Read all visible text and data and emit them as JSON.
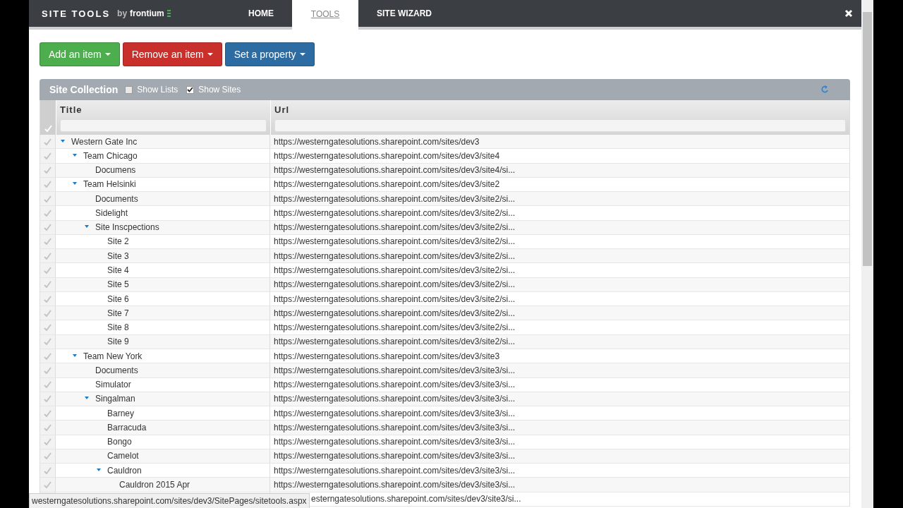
{
  "navbar": {
    "brand": "SITE TOOLS",
    "brand_by": "by",
    "brand_company": "frontium",
    "tabs": [
      {
        "label": "HOME",
        "selected": false
      },
      {
        "label": "TOOLS",
        "selected": true
      },
      {
        "label": "SITE WIZARD",
        "selected": false
      }
    ]
  },
  "actions": [
    {
      "label": "Add an item",
      "kind": "success"
    },
    {
      "label": "Remove an item",
      "kind": "danger"
    },
    {
      "label": "Set a property",
      "kind": "primary"
    }
  ],
  "panel": {
    "title": "Site Collection",
    "options": [
      {
        "label": "Show Lists",
        "checked": false
      },
      {
        "label": "Show Sites",
        "checked": true
      }
    ]
  },
  "table": {
    "columns": [
      "Title",
      "Url"
    ],
    "rows": [
      {
        "title": "Western Gate Inc",
        "url": "https://westerngatesolutions.sharepoint.com/sites/dev3",
        "expanded": true,
        "children": [
          {
            "title": "Team Chicago",
            "url": "https://westerngatesolutions.sharepoint.com/sites/dev3/site4",
            "expanded": true,
            "children": [
              {
                "title": "Documens",
                "url": "https://westerngatesolutions.sharepoint.com/sites/dev3/site4/si..."
              }
            ]
          },
          {
            "title": "Team Helsinki",
            "url": "https://westerngatesolutions.sharepoint.com/sites/dev3/site2",
            "expanded": true,
            "children": [
              {
                "title": "Documents",
                "url": "https://westerngatesolutions.sharepoint.com/sites/dev3/site2/si..."
              },
              {
                "title": "Sidelight",
                "url": "https://westerngatesolutions.sharepoint.com/sites/dev3/site2/si..."
              },
              {
                "title": "Site Inscpections",
                "url": "https://westerngatesolutions.sharepoint.com/sites/dev3/site2/si...",
                "expanded": true,
                "children": [
                  {
                    "title": "Site 2",
                    "url": "https://westerngatesolutions.sharepoint.com/sites/dev3/site2/si..."
                  },
                  {
                    "title": "Site 3",
                    "url": "https://westerngatesolutions.sharepoint.com/sites/dev3/site2/si..."
                  },
                  {
                    "title": "Site 4",
                    "url": "https://westerngatesolutions.sharepoint.com/sites/dev3/site2/si..."
                  },
                  {
                    "title": "Site 5",
                    "url": "https://westerngatesolutions.sharepoint.com/sites/dev3/site2/si..."
                  },
                  {
                    "title": "Site 6",
                    "url": "https://westerngatesolutions.sharepoint.com/sites/dev3/site2/si..."
                  },
                  {
                    "title": "Site 7",
                    "url": "https://westerngatesolutions.sharepoint.com/sites/dev3/site2/si..."
                  },
                  {
                    "title": "Site 8",
                    "url": "https://westerngatesolutions.sharepoint.com/sites/dev3/site2/si..."
                  },
                  {
                    "title": "Site 9",
                    "url": "https://westerngatesolutions.sharepoint.com/sites/dev3/site2/si..."
                  }
                ]
              }
            ]
          },
          {
            "title": "Team New York",
            "url": "https://westerngatesolutions.sharepoint.com/sites/dev3/site3",
            "expanded": true,
            "children": [
              {
                "title": "Documents",
                "url": "https://westerngatesolutions.sharepoint.com/sites/dev3/site3/si..."
              },
              {
                "title": "Simulator",
                "url": "https://westerngatesolutions.sharepoint.com/sites/dev3/site3/si..."
              },
              {
                "title": "Singalman",
                "url": "https://westerngatesolutions.sharepoint.com/sites/dev3/site3/si...",
                "expanded": true,
                "children": [
                  {
                    "title": "Barney",
                    "url": "https://westerngatesolutions.sharepoint.com/sites/dev3/site3/si..."
                  },
                  {
                    "title": "Barracuda",
                    "url": "https://westerngatesolutions.sharepoint.com/sites/dev3/site3/si..."
                  },
                  {
                    "title": "Bongo",
                    "url": "https://westerngatesolutions.sharepoint.com/sites/dev3/site3/si..."
                  },
                  {
                    "title": "Camelot",
                    "url": "https://westerngatesolutions.sharepoint.com/sites/dev3/site3/si..."
                  },
                  {
                    "title": "Cauldron",
                    "url": "https://westerngatesolutions.sharepoint.com/sites/dev3/site3/si...",
                    "expanded": true,
                    "children": [
                      {
                        "title": "Cauldron 2015 Apr",
                        "url": "https://westerngatesolutions.sharepoint.com/sites/dev3/site3/si..."
                      },
                      {
                        "url": "esterngatesolutions.sharepoint.com/sites/dev3/site3/si..."
                      }
                    ]
                  }
                ]
              }
            ]
          }
        ]
      }
    ]
  },
  "status_bar": "westerngatesolutions.sharepoint.com/sites/dev3/SitePages/sitetools.aspx"
}
